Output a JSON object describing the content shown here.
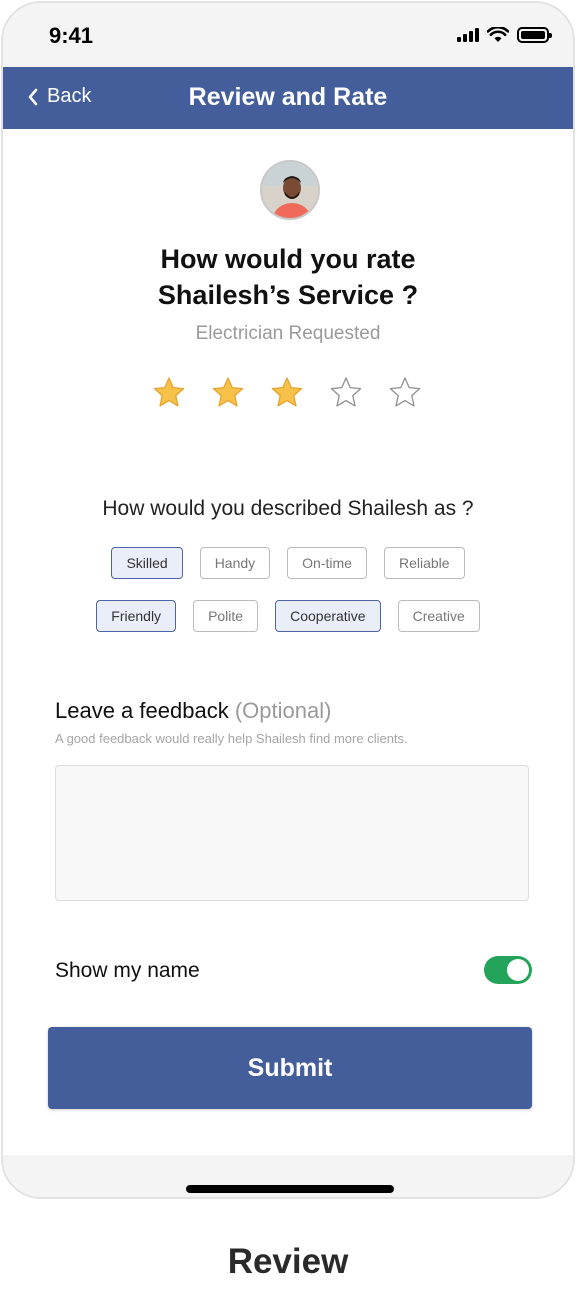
{
  "status_bar": {
    "time": "9:41"
  },
  "navbar": {
    "back_label": "Back",
    "title": "Review and Rate"
  },
  "rating": {
    "question_line1": "How would you rate",
    "question_line2": "Shailesh’s Service ?",
    "subtitle": "Electrician Requested",
    "stars_filled": 3,
    "stars_total": 5,
    "star_color": "#f8c14a"
  },
  "describe": {
    "question": "How would you described Shailesh as ?",
    "row1": [
      {
        "label": "Skilled",
        "selected": true
      },
      {
        "label": "Handy",
        "selected": false
      },
      {
        "label": "On-time",
        "selected": false
      },
      {
        "label": "Reliable",
        "selected": false
      }
    ],
    "row2": [
      {
        "label": "Friendly",
        "selected": true
      },
      {
        "label": "Polite",
        "selected": false
      },
      {
        "label": "Cooperative",
        "selected": true
      },
      {
        "label": "Creative",
        "selected": false
      }
    ]
  },
  "feedback": {
    "title": "Leave a feedback",
    "optional": "(Optional)",
    "hint": "A good feedback would really help Shailesh find more clients.",
    "value": ""
  },
  "show_name": {
    "label": "Show my name",
    "enabled": true,
    "toggle_color": "#24a35a"
  },
  "submit": {
    "label": "Submit"
  },
  "caption": "Review",
  "colors": {
    "primary": "#435e9b",
    "chip_selected_border": "#4d65a8"
  }
}
